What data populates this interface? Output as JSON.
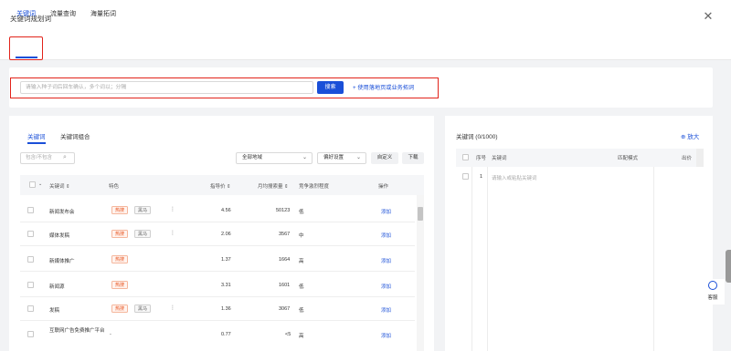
{
  "dialog": {
    "title": "关键词规划词",
    "close_icon": "close-icon"
  },
  "tabs": [
    {
      "label": "关键词",
      "active": true
    },
    {
      "label": "流量查询"
    },
    {
      "label": "海量拓词"
    }
  ],
  "search": {
    "placeholder": "请输入种子词后回车确认，多个词以；分隔",
    "button_label": "搜索",
    "landing_link": "+ 使用落地页或业务拓词"
  },
  "left": {
    "subtabs": [
      {
        "label": "关键词",
        "active": true
      },
      {
        "label": "关键词组合"
      }
    ],
    "filter_placeholder": "包含/不包含",
    "region_select": "全部地域",
    "preference_select": "偏好设置",
    "custom_button": "自定义",
    "download_button": "下载",
    "columns": [
      "关键词 ⇕",
      "特色",
      "指导价 ⇕",
      "月均搜索量 ⇕",
      "竞争激烈程度",
      "操作"
    ],
    "rows": [
      {
        "keyword": "新闻发布会",
        "tags": [
          "热搜",
          "黑马"
        ],
        "more": true,
        "price": "4.56",
        "volume": "50123",
        "competition": "低",
        "action": "添加"
      },
      {
        "keyword": "媒体发稿",
        "tags": [
          "热搜",
          "黑马"
        ],
        "more": true,
        "price": "2.06",
        "volume": "3567",
        "competition": "中",
        "action": "添加"
      },
      {
        "keyword": "新媒体推广",
        "tags": [
          "热搜"
        ],
        "more": false,
        "price": "1.37",
        "volume": "1664",
        "competition": "高",
        "action": "添加"
      },
      {
        "keyword": "新闻源",
        "tags": [
          "热搜"
        ],
        "more": false,
        "price": "3.31",
        "volume": "1601",
        "competition": "低",
        "action": "添加"
      },
      {
        "keyword": "发稿",
        "tags": [
          "热搜",
          "黑马"
        ],
        "more": true,
        "price": "1.36",
        "volume": "3067",
        "competition": "低",
        "action": "添加"
      },
      {
        "keyword": "互联网广告免费推广平台",
        "tags": [],
        "dash": "-",
        "more": false,
        "price": "0.77",
        "volume": "<5",
        "competition": "高",
        "action": "添加"
      }
    ]
  },
  "right": {
    "title": "关键词 (0/1000)",
    "zoom_label": "放大",
    "columns": [
      "序号",
      "关键词",
      "匹配模式",
      "出价"
    ],
    "row_index": "1",
    "row_placeholder": "请输入或粘贴关键词"
  },
  "help": {
    "label": "客服"
  },
  "colors": {
    "accent": "#1a4fd8",
    "highlight": "#e2231a",
    "hot_tag": "#e8521c"
  }
}
